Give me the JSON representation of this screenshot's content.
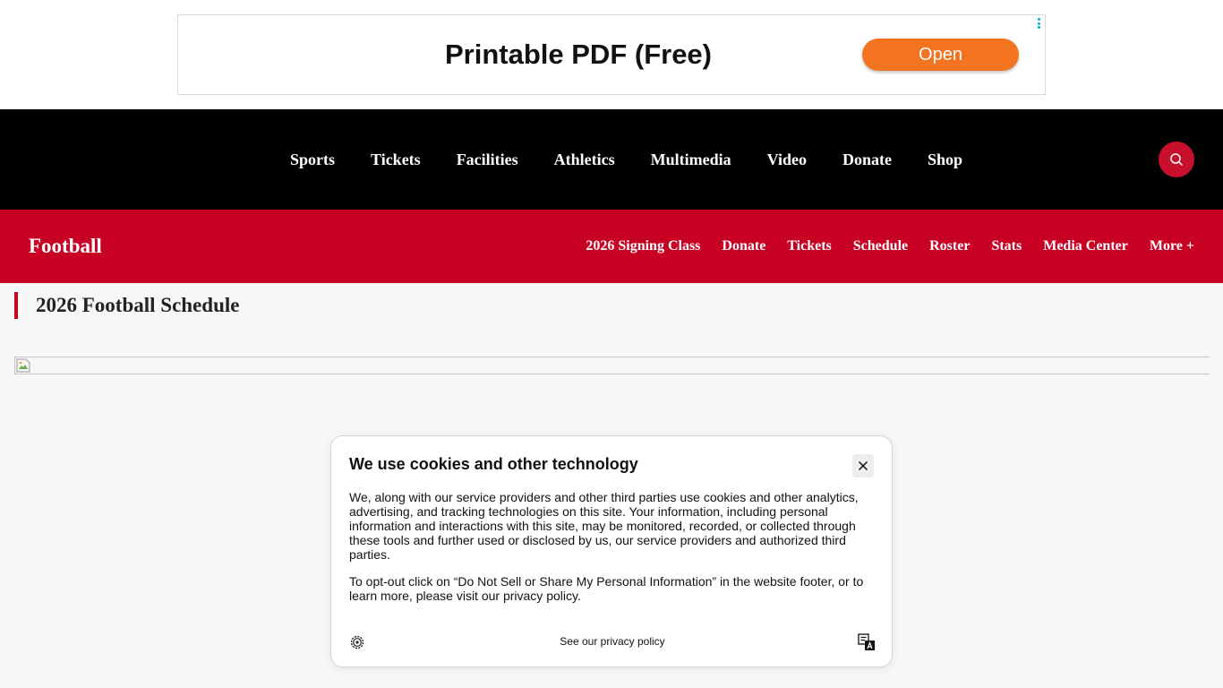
{
  "ad": {
    "title": "Printable PDF (Free)",
    "button_label": "Open",
    "accent": "#f47321",
    "menu_icon": "ad-options-icon"
  },
  "topnav": {
    "items": [
      "Sports",
      "Tickets",
      "Facilities",
      "Athletics",
      "Multimedia",
      "Video",
      "Donate",
      "Shop"
    ],
    "search_icon": "search-icon",
    "accent": "#c8102e"
  },
  "subnav": {
    "sport": "Football",
    "items": [
      "2026 Signing Class",
      "Donate",
      "Tickets",
      "Schedule",
      "Roster",
      "Stats",
      "Media Center",
      "More +"
    ],
    "color": "#c80024"
  },
  "page": {
    "heading": "2026 Football Schedule"
  },
  "cookie": {
    "title": "We use cookies and other technology",
    "paragraph1": "We, along with our service providers and other third parties use cookies and other analytics, advertising, and tracking technologies on this site. Your information, including personal information and interactions with this site, may be monitored, recorded, or collected through these tools and further used or disclosed by us, our service providers and authorized third parties.",
    "paragraph2": "To opt-out click on “Do Not Sell or Share My Personal Information” in the website footer, or to learn more, please visit our privacy policy.",
    "privacy_link": "See our privacy policy",
    "close_icon": "close-icon",
    "settings_icon": "gear-icon",
    "language_icon": "translate-icon"
  }
}
